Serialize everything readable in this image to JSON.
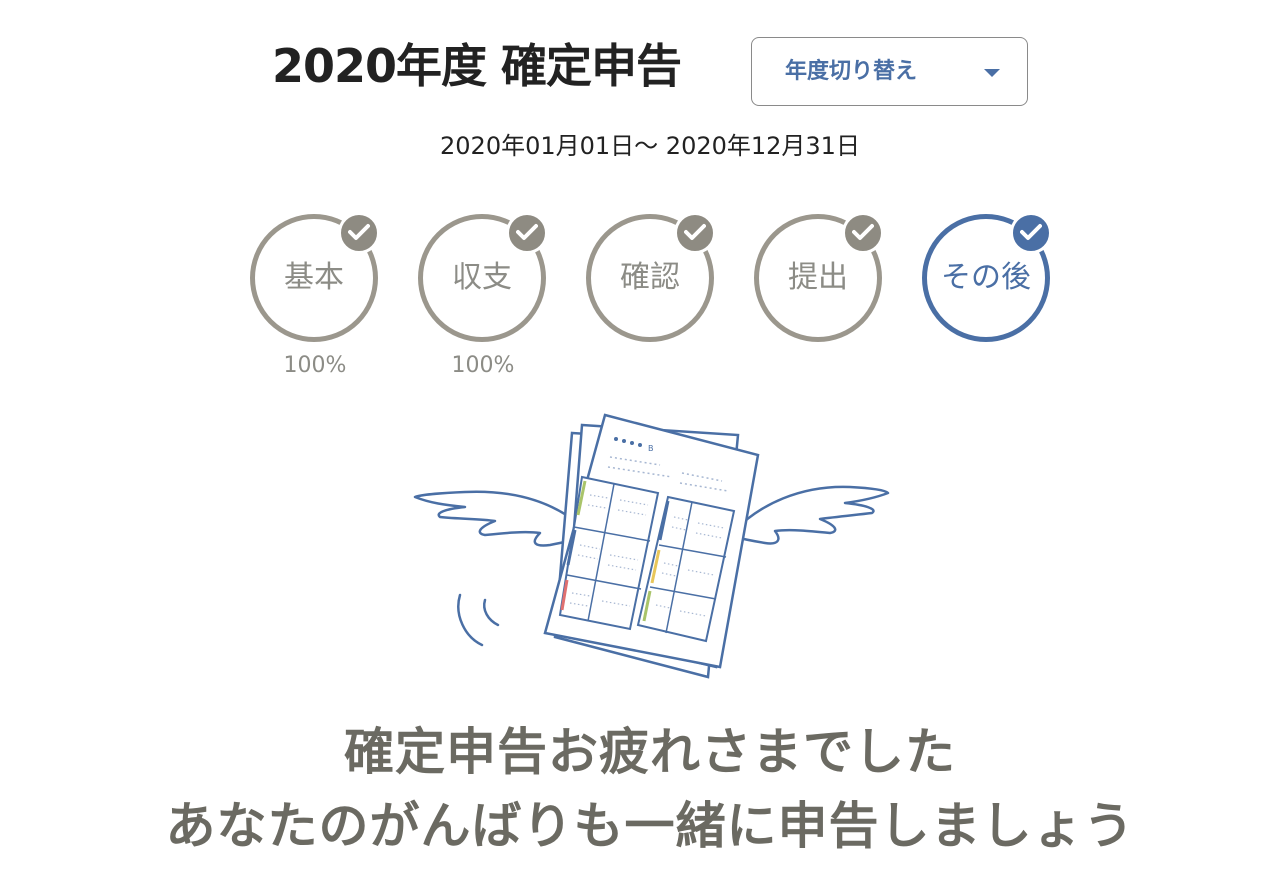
{
  "header": {
    "title": "2020年度 確定申告",
    "year_switch_label": "年度切り替え",
    "period": "2020年01月01日〜 2020年12月31日"
  },
  "steps": [
    {
      "label": "基本",
      "progress": "100%",
      "completed": true,
      "active": false
    },
    {
      "label": "収支",
      "progress": "100%",
      "completed": true,
      "active": false
    },
    {
      "label": "確認",
      "progress": "",
      "completed": true,
      "active": false
    },
    {
      "label": "提出",
      "progress": "",
      "completed": true,
      "active": false
    },
    {
      "label": "その後",
      "progress": "",
      "completed": true,
      "active": true
    }
  ],
  "illustration": {
    "document_marker": "B"
  },
  "message": {
    "line1": "確定申告お疲れさまでした",
    "line2": "あなたのがんばりも一緒に申告しましょう"
  },
  "colors": {
    "accent": "#4a6fa5",
    "step_gray": "#9b978d",
    "message_text": "#6b6a62",
    "title_text": "#222222"
  },
  "icons": {
    "dropdown": "chevron-down-icon",
    "check": "check-icon"
  }
}
